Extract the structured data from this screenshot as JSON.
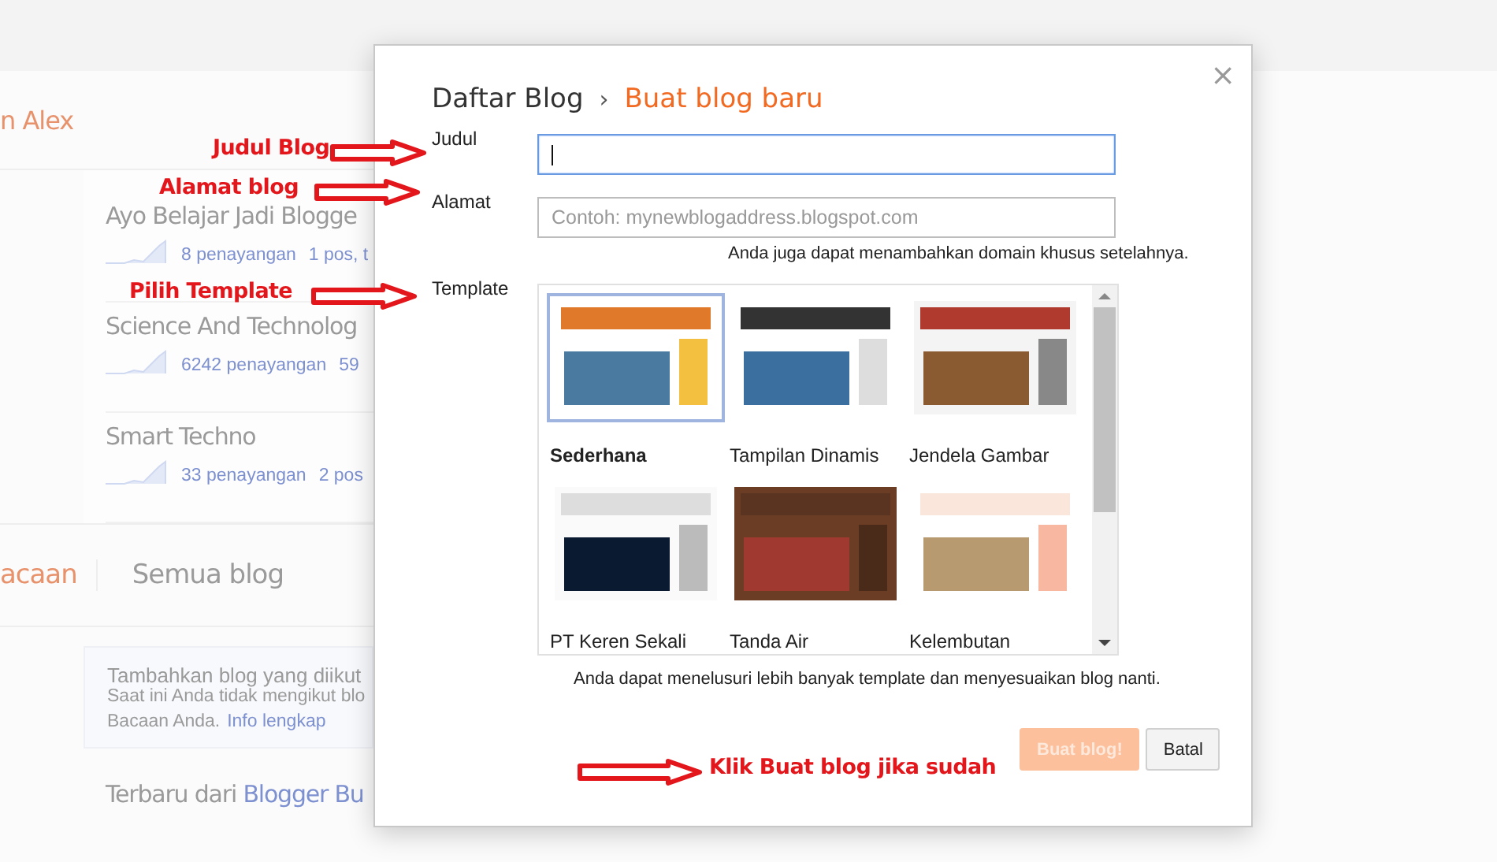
{
  "background": {
    "header": "n Alex",
    "blogs": [
      {
        "title": "Ayo Belajar Jadi Blogge",
        "views": "8 penayangan",
        "posts": "1 pos, t"
      },
      {
        "title": "Science And Technolog",
        "views": "6242 penayangan",
        "posts": "59"
      },
      {
        "title": "Smart Techno",
        "views": "33 penayangan",
        "posts": "2 pos"
      }
    ],
    "tabs": [
      {
        "label": "acaan",
        "selected": true
      },
      {
        "label": "Semua blog",
        "selected": false
      }
    ],
    "notice": {
      "title": "Tambahkan blog yang diikut",
      "text": "Saat ini Anda tidak mengikut blo",
      "text2": "Bacaan Anda.",
      "link": "Info lengkap"
    },
    "footer": {
      "text": "Terbaru dari",
      "link": "Blogger Bu"
    }
  },
  "dialog": {
    "breadcrumb": "Daftar Blog",
    "separator": "›",
    "title": "Buat blog baru",
    "close": "×",
    "title_label": "Judul",
    "title_field": {
      "focused": true
    },
    "address_label": "Alamat",
    "address_field": {
      "placeholder": "Contoh: mynewblogaddress.blogspot.com"
    },
    "address_hint": "Anda juga dapat menambahkan domain khusus setelahnya.",
    "template_label": "Template",
    "templates": [
      {
        "name": "Sederhana",
        "selected": true
      },
      {
        "name": "Tampilan Dinamis",
        "selected": false
      },
      {
        "name": "Jendela Gambar",
        "selected": false
      },
      {
        "name": "PT Keren Sekali",
        "selected": false
      },
      {
        "name": "Tanda Air",
        "selected": false
      },
      {
        "name": "Kelembutan",
        "selected": false
      }
    ],
    "template_hint": "Anda dapat menelusuri lebih banyak template dan menyesuaikan blog nanti.",
    "buttons": [
      {
        "label": "Buat blog!",
        "kind": "primary",
        "disabled": true
      },
      {
        "label": "Batal",
        "kind": "secondary",
        "disabled": false
      }
    ]
  },
  "annotations": [
    {
      "text": "Judul Blog"
    },
    {
      "text": "Alamat blog"
    },
    {
      "text": "Pilih Template"
    },
    {
      "text": "Klik Buat blog jika sudah"
    }
  ]
}
